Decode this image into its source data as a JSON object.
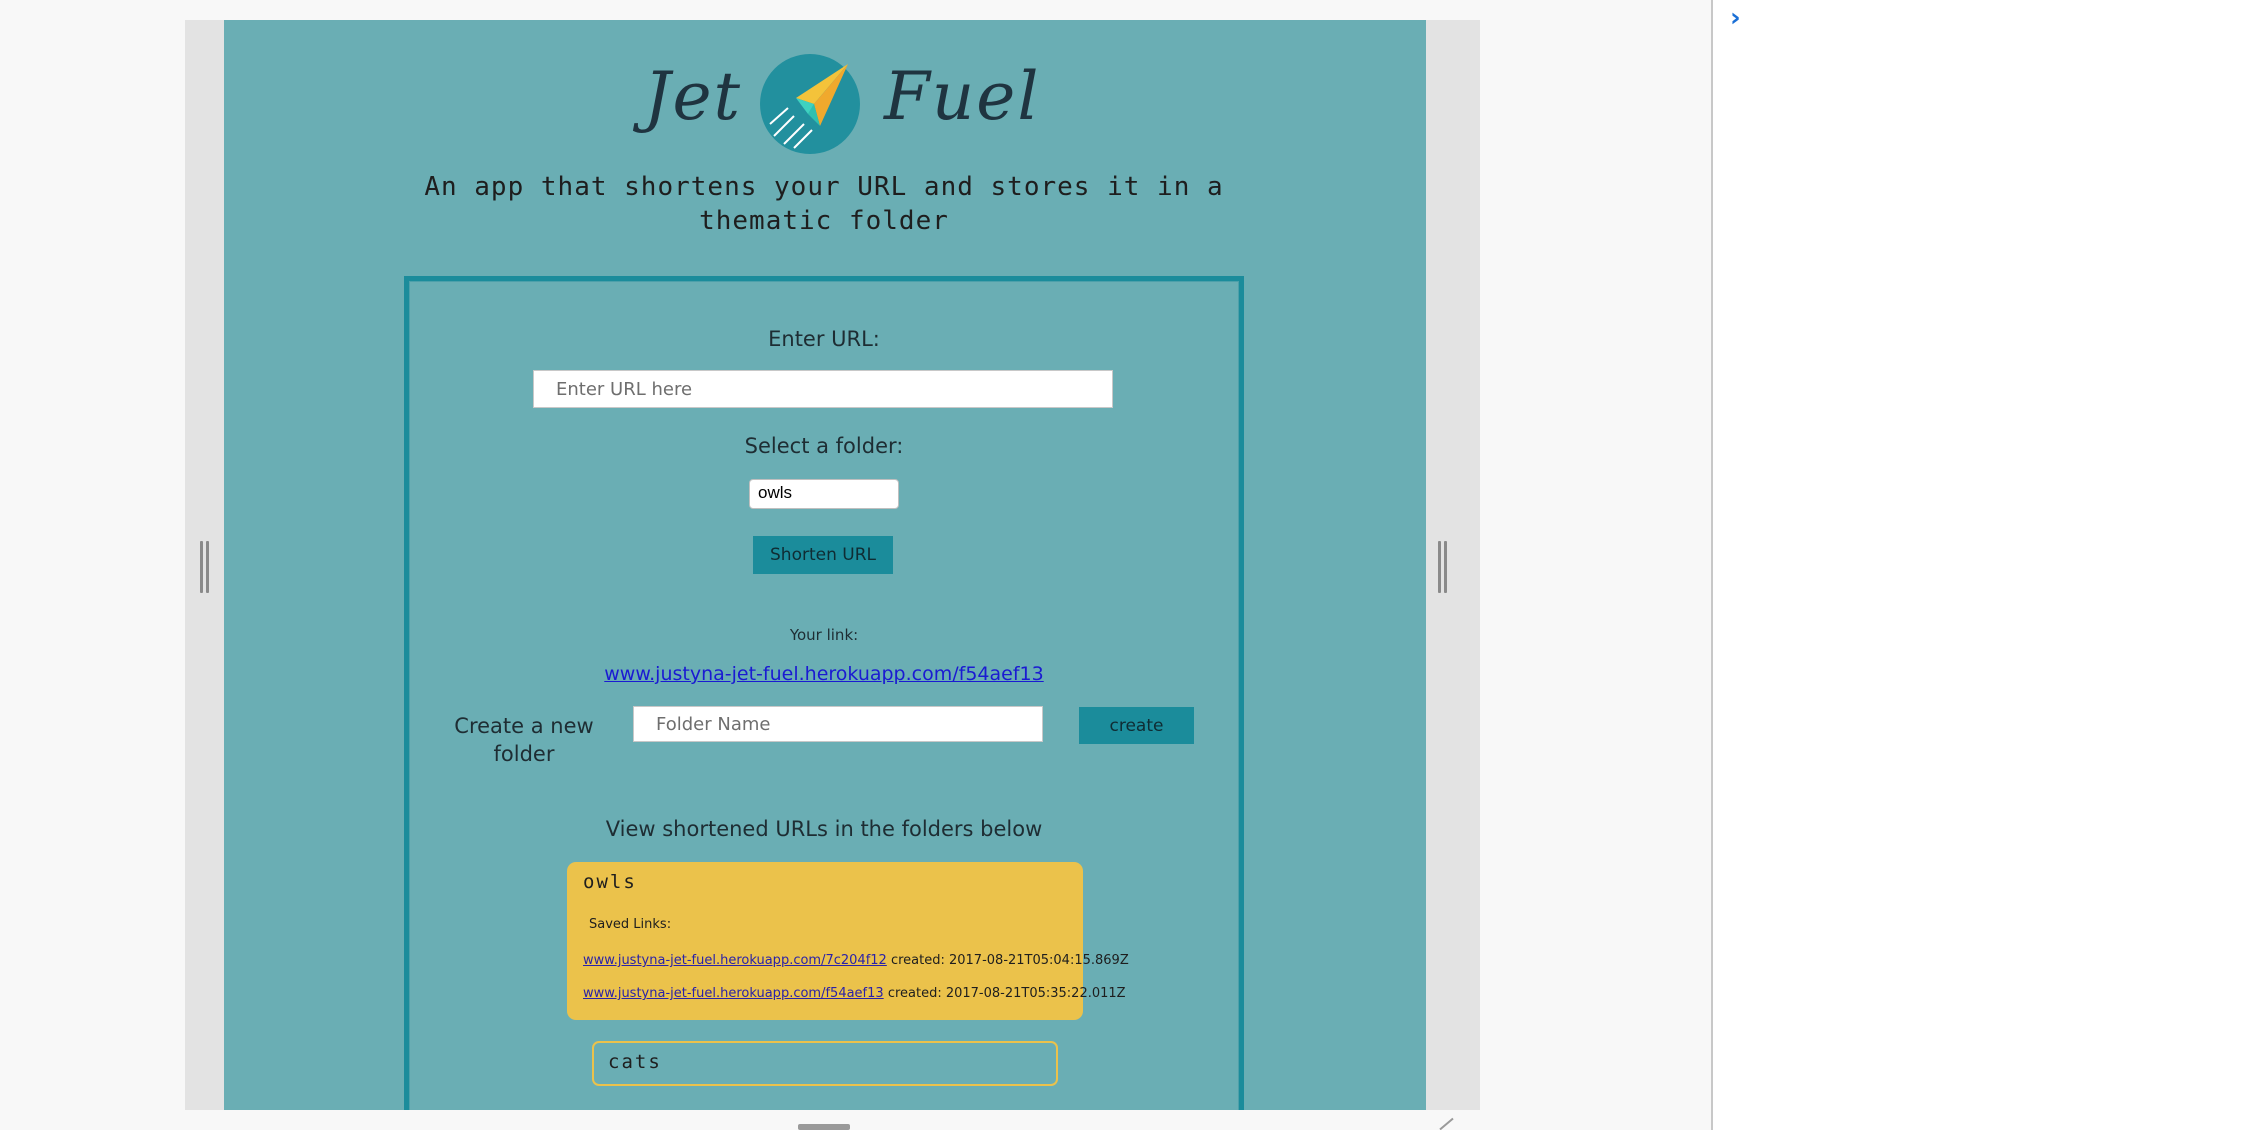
{
  "app": {
    "logo_left": "Jet",
    "logo_right": "Fuel",
    "tagline": "An app that shortens your URL and stores it in a thematic folder"
  },
  "form": {
    "url_label": "Enter URL:",
    "url_placeholder": "Enter URL here",
    "folder_label": "Select a folder:",
    "selected_folder": "owls",
    "shorten_button": "Shorten URL",
    "your_link_label": "Your link:",
    "result_link": "www.justyna-jet-fuel.herokuapp.com/f54aef13"
  },
  "create_folder": {
    "label": "Create a new folder",
    "placeholder": "Folder Name",
    "button": "create"
  },
  "folders": {
    "heading": "View shortened URLs in the folders below",
    "owls": {
      "title": "owls",
      "saved_links_label": "Saved Links:",
      "links": [
        {
          "url": "www.justyna-jet-fuel.herokuapp.com/7c204f12",
          "created": "created: 2017-08-21T05:04:15.869Z"
        },
        {
          "url": "www.justyna-jet-fuel.herokuapp.com/f54aef13",
          "created": "created: 2017-08-21T05:35:22.011Z"
        }
      ]
    },
    "cats": {
      "title": "cats"
    }
  },
  "colors": {
    "page_background": "#6aaeb4",
    "accent_teal": "#1b8c9b",
    "folder_yellow": "#ebc24b",
    "link_blue": "#1a1ad2"
  },
  "icons": {
    "logo": "paper-plane-icon",
    "devtools_prompt": "chevron-right-icon"
  }
}
